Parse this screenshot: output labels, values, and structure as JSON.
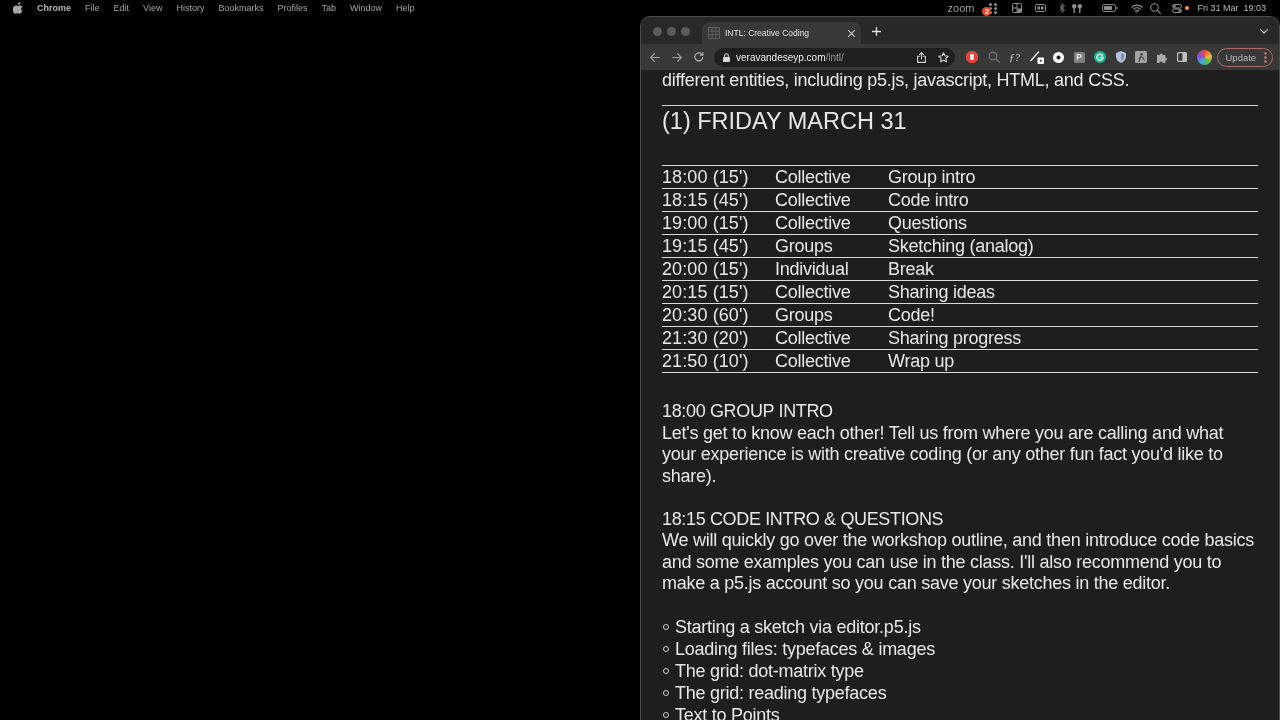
{
  "menu_bar": {
    "app_name": "Chrome",
    "menus": [
      "File",
      "Edit",
      "View",
      "History",
      "Bookmarks",
      "Profiles",
      "Tab",
      "Window",
      "Help"
    ],
    "status_text": "zoom",
    "notification_badge": "2",
    "date": "Fri 31 Mar",
    "time": "19:03"
  },
  "browser": {
    "tabs": [
      {
        "title": "INTL: Creative Coding",
        "selected": true
      }
    ],
    "address": {
      "host": "veravandeseyp.com",
      "path": "/intl/"
    },
    "extensions": [
      {
        "kind": "glyph",
        "label": "ƒ?"
      },
      {
        "kind": "tile",
        "label": "P"
      }
    ],
    "update_button": "Update"
  },
  "page": {
    "intro_text": "different entities, including p5.js, javascript, HTML, and CSS.",
    "day_heading": "(1) FRIDAY MARCH 31",
    "schedule": {
      "rows": [
        [
          "18:00 (15')",
          "Collective",
          "Group intro"
        ],
        [
          "18:15 (45')",
          "Collective",
          "Code intro"
        ],
        [
          "19:00 (15')",
          "Collective",
          "Questions"
        ],
        [
          "19:15 (45')",
          "Groups",
          "Sketching (analog)"
        ],
        [
          "20:00 (15')",
          "Individual",
          "Break"
        ],
        [
          "20:15 (15')",
          "Collective",
          "Sharing ideas"
        ],
        [
          "20:30 (60')",
          "Groups",
          "Code!"
        ],
        [
          "21:30 (20')",
          "Collective",
          "Sharing progress"
        ],
        [
          "21:50 (10')",
          "Collective",
          "Wrap up"
        ]
      ]
    },
    "sections": [
      {
        "heading": "18:00 GROUP INTRO",
        "text": "Let's get to know each other! Tell us from where you are calling and what your experience is with creative coding (or any other fun fact you'd like to share)."
      },
      {
        "heading": "18:15 CODE INTRO & QUESTIONS",
        "text": "We will quickly go over the workshop outline, and then introduce code basics and some examples you can use in the class. I'll also recommend you to make a p5.js account so you can save your sketches in the editor.",
        "list": [
          "Starting a sketch via editor.p5.js",
          "Loading files: typefaces & images",
          "The grid: dot-matrix type",
          "The grid: reading typefaces",
          "Text to Points"
        ]
      }
    ]
  }
}
